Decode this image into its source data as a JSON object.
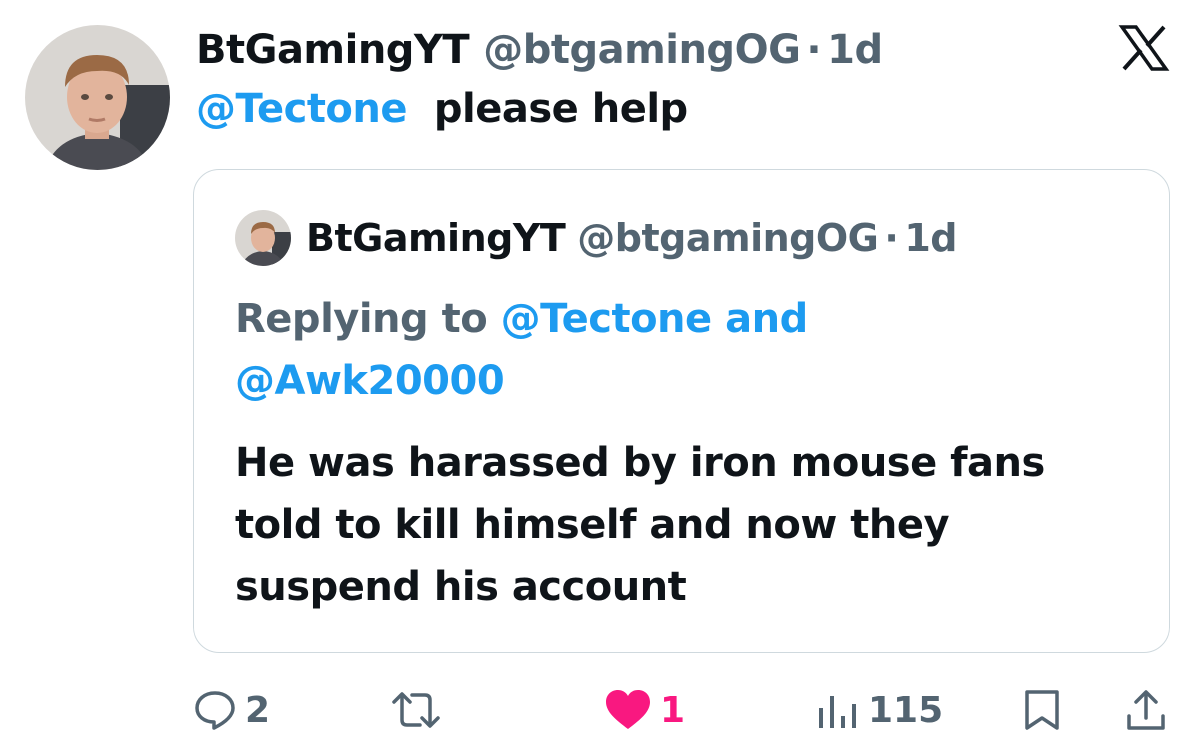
{
  "tweet": {
    "author_name": "BtGamingYT",
    "author_handle": "@btgamingOG",
    "separator": "·",
    "time": "1d",
    "mention": "@Tectone",
    "text": "please help"
  },
  "quoted_tweet": {
    "author_name": "BtGamingYT",
    "author_handle": "@btgamingOG",
    "separator": "·",
    "time": "1d",
    "replying_label": "Replying to",
    "replying_mention_1": "@Tectone",
    "replying_and": "and",
    "replying_mention_2": "@Awk20000",
    "body": "He was harassed by iron mouse fans told to kill himself and now they suspend his account"
  },
  "actions": {
    "replies": "2",
    "likes": "1",
    "views": "115"
  },
  "icons": {
    "close": "x-logo-icon",
    "reply": "speech-bubble-icon",
    "retweet": "retweet-icon",
    "like": "heart-icon",
    "views": "bar-chart-icon",
    "bookmark": "bookmark-icon",
    "share": "share-icon"
  },
  "colors": {
    "mention": "#1d9bf0",
    "secondary_text": "#536471",
    "like": "#f91880",
    "border": "#cfd9de"
  }
}
